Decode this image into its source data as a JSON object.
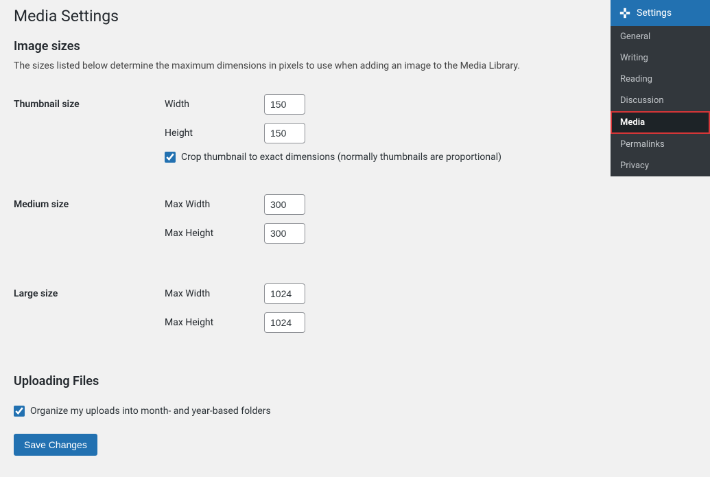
{
  "page": {
    "title": "Media Settings"
  },
  "image_sizes": {
    "heading": "Image sizes",
    "description": "The sizes listed below determine the maximum dimensions in pixels to use when adding an image to the Media Library.",
    "thumbnail": {
      "label": "Thumbnail size",
      "width_label": "Width",
      "width_value": "150",
      "height_label": "Height",
      "height_value": "150",
      "crop_label": "Crop thumbnail to exact dimensions (normally thumbnails are proportional)",
      "crop_checked": true
    },
    "medium": {
      "label": "Medium size",
      "max_width_label": "Max Width",
      "max_width_value": "300",
      "max_height_label": "Max Height",
      "max_height_value": "300"
    },
    "large": {
      "label": "Large size",
      "max_width_label": "Max Width",
      "max_width_value": "1024",
      "max_height_label": "Max Height",
      "max_height_value": "1024"
    }
  },
  "uploading": {
    "heading": "Uploading Files",
    "organize_label": "Organize my uploads into month- and year-based folders",
    "organize_checked": true
  },
  "buttons": {
    "save": "Save Changes"
  },
  "sidebar": {
    "header": "Settings",
    "items": [
      {
        "label": "General",
        "active": false
      },
      {
        "label": "Writing",
        "active": false
      },
      {
        "label": "Reading",
        "active": false
      },
      {
        "label": "Discussion",
        "active": false
      },
      {
        "label": "Media",
        "active": true
      },
      {
        "label": "Permalinks",
        "active": false
      },
      {
        "label": "Privacy",
        "active": false
      }
    ]
  }
}
